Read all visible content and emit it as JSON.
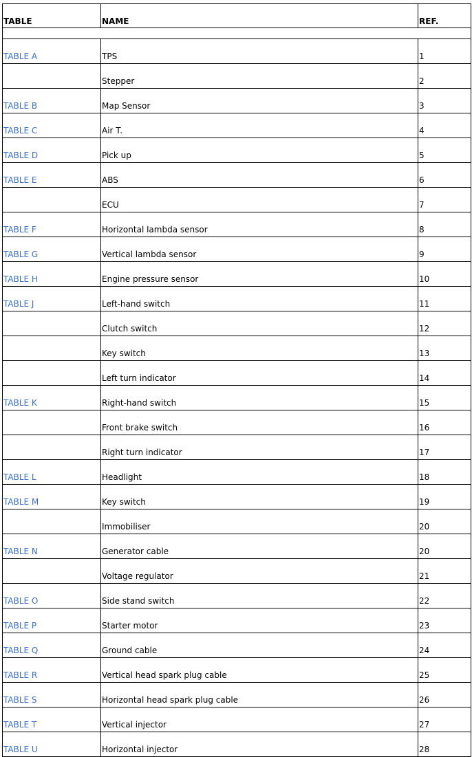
{
  "headers": {
    "table": "TABLE",
    "name": "NAME",
    "ref": "REF."
  },
  "colors": {
    "link": "#3b6fd4"
  },
  "rows": [
    {
      "table": "TABLE A",
      "name": "TPS",
      "ref": "1"
    },
    {
      "table": "",
      "name": "Stepper",
      "ref": "2"
    },
    {
      "table": "TABLE B",
      "name": "Map Sensor",
      "ref": "3"
    },
    {
      "table": "TABLE C",
      "name": "Air T.",
      "ref": "4"
    },
    {
      "table": "TABLE D",
      "name": "Pick up",
      "ref": "5"
    },
    {
      "table": "TABLE E",
      "name": "ABS",
      "ref": "6"
    },
    {
      "table": "",
      "name": "ECU",
      "ref": "7"
    },
    {
      "table": "TABLE F",
      "name": "Horizontal lambda sensor",
      "ref": "8"
    },
    {
      "table": "TABLE G",
      "name": "Vertical lambda sensor",
      "ref": "9"
    },
    {
      "table": "TABLE H",
      "name": "Engine pressure sensor",
      "ref": "10"
    },
    {
      "table": "TABLE J",
      "name": "Left-hand switch",
      "ref": "11"
    },
    {
      "table": "",
      "name": "Clutch switch",
      "ref": "12"
    },
    {
      "table": "",
      "name": "Key switch",
      "ref": "13"
    },
    {
      "table": "",
      "name": "Left turn indicator",
      "ref": "14"
    },
    {
      "table": "TABLE K",
      "name": "Right-hand switch",
      "ref": "15"
    },
    {
      "table": "",
      "name": "Front brake switch",
      "ref": "16"
    },
    {
      "table": "",
      "name": "Right turn indicator",
      "ref": "17"
    },
    {
      "table": "TABLE L",
      "name": "Headlight",
      "ref": "18"
    },
    {
      "table": "TABLE M",
      "name": "Key switch",
      "ref": "19"
    },
    {
      "table": "",
      "name": "Immobiliser",
      "ref": "20"
    },
    {
      "table": "TABLE N",
      "name": "Generator cable",
      "ref": "20"
    },
    {
      "table": "",
      "name": "Voltage regulator",
      "ref": "21"
    },
    {
      "table": "TABLE O",
      "name": "Side stand switch",
      "ref": "22"
    },
    {
      "table": "TABLE P",
      "name": "Starter motor",
      "ref": "23"
    },
    {
      "table": "TABLE Q",
      "name": "Ground cable",
      "ref": "24"
    },
    {
      "table": "TABLE R",
      "name": "Vertical head spark plug cable",
      "ref": "25"
    },
    {
      "table": "TABLE S",
      "name": "Horizontal head spark plug cable",
      "ref": "26"
    },
    {
      "table": "TABLE T",
      "name": "Vertical injector",
      "ref": "27"
    },
    {
      "table": "TABLE U",
      "name": "Horizontal injector",
      "ref": "28"
    }
  ]
}
